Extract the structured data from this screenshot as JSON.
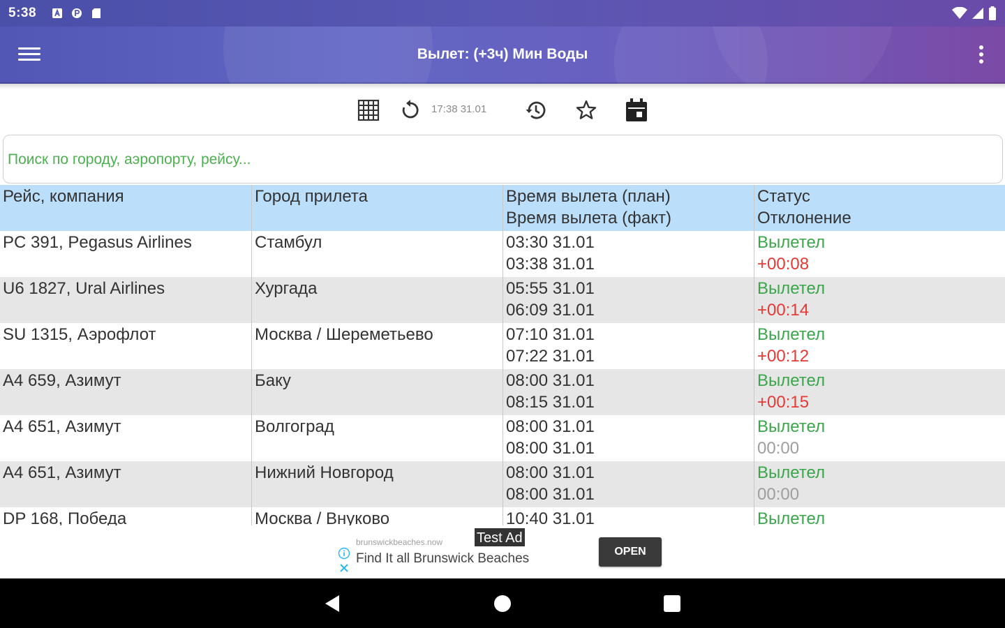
{
  "status_bar": {
    "time": "5:38",
    "icons_left": [
      "notification-a-icon",
      "pocket-icon",
      "sd-card-icon"
    ],
    "icons_right": [
      "wifi-icon",
      "signal-icon",
      "battery-icon"
    ]
  },
  "app_bar": {
    "title": "Вылет: (+3ч) Мин Воды",
    "menu_icon": "hamburger-menu-icon",
    "overflow_icon": "more-vert-icon"
  },
  "toolbar": {
    "update_time": "17:38 31.01",
    "icons": [
      "grid-icon",
      "refresh-icon",
      "history-icon",
      "star-icon",
      "calendar-icon"
    ]
  },
  "search": {
    "placeholder": "Поиск по городу, аэропорту, рейсу..."
  },
  "table": {
    "headers": {
      "flight": "Рейс, компания",
      "city": "Город прилета",
      "time_plan": "Время вылета (план)",
      "time_fact": "Время вылета (факт)",
      "status": "Статус",
      "deviation": "Отклонение"
    },
    "rows": [
      {
        "flight": "PC 391, Pegasus Airlines",
        "city": "Стамбул",
        "plan": "03:30 31.01",
        "fact": "03:38 31.01",
        "status": "Вылетел",
        "deviation": "+00:08"
      },
      {
        "flight": "U6 1827, Ural Airlines",
        "city": "Хургада",
        "plan": "05:55 31.01",
        "fact": "06:09 31.01",
        "status": "Вылетел",
        "deviation": "+00:14"
      },
      {
        "flight": "SU 1315, Аэрофлот",
        "city": "Москва / Шереметьево",
        "plan": "07:10 31.01",
        "fact": "07:22 31.01",
        "status": "Вылетел",
        "deviation": "+00:12"
      },
      {
        "flight": "A4 659, Азимут",
        "city": "Баку",
        "plan": "08:00 31.01",
        "fact": "08:15 31.01",
        "status": "Вылетел",
        "deviation": "+00:15"
      },
      {
        "flight": "A4 651, Азимут",
        "city": "Волгоград",
        "plan": "08:00 31.01",
        "fact": "08:00 31.01",
        "status": "Вылетел",
        "deviation": "00:00"
      },
      {
        "flight": "A4 651, Азимут",
        "city": "Нижний Новгород",
        "plan": "08:00 31.01",
        "fact": "08:00 31.01",
        "status": "Вылетел",
        "deviation": "00:00"
      },
      {
        "flight": "DP 168, Победа",
        "city": "Москва / Внуково",
        "plan": "10:40 31.01",
        "fact": "",
        "status": "Вылетел",
        "deviation": ""
      }
    ]
  },
  "ad": {
    "badge": "Test Ad",
    "domain": "brunswickbeaches.now",
    "text": "Find It all Brunswick Beaches",
    "button": "OPEN"
  },
  "nav_bar": {
    "icons": [
      "back-icon",
      "home-icon",
      "recents-icon"
    ]
  },
  "colors": {
    "app_bar_start": "#5256b4",
    "app_bar_end": "#7b4aa6",
    "header_bg": "#bbdefb",
    "alt_row_bg": "#e6e6e6",
    "status_green": "#3aa64a",
    "deviation_red": "#e53935",
    "deviation_zero": "#9e9e9e"
  }
}
